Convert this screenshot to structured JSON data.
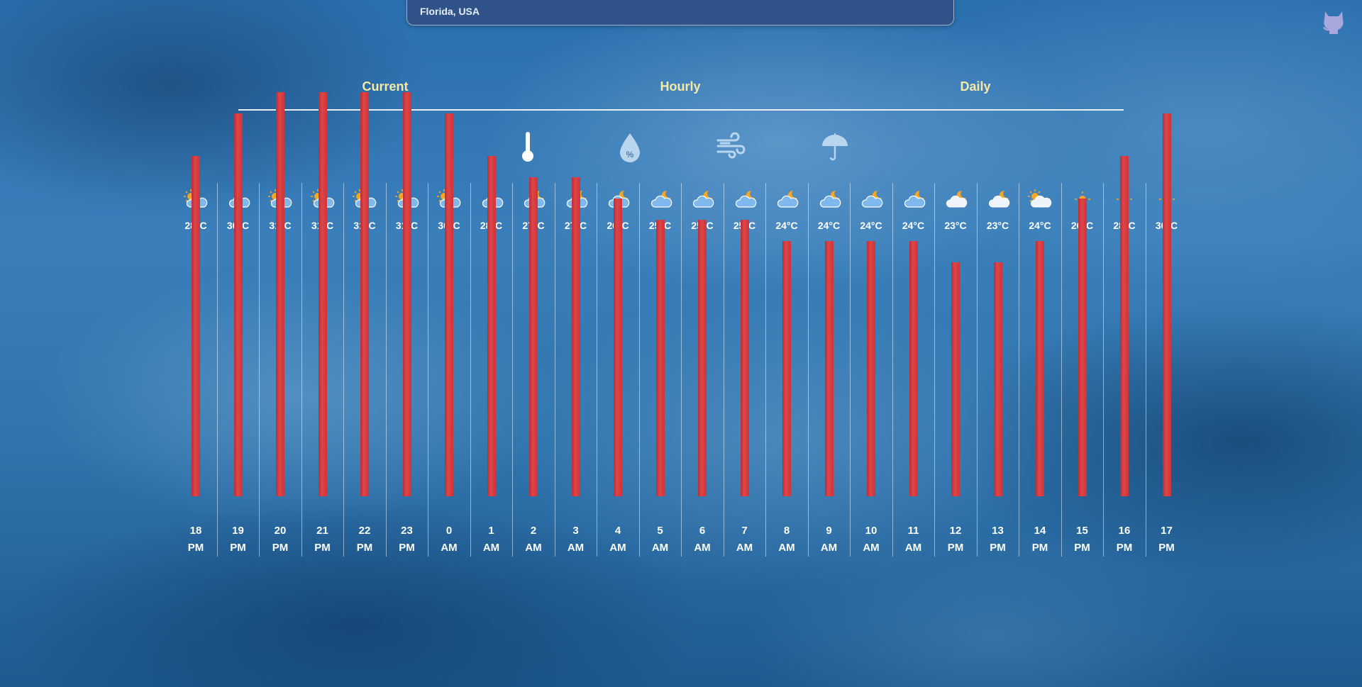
{
  "search": {
    "value": "Florida, USA"
  },
  "header": {
    "github_icon": "github-octocat-icon"
  },
  "tabs": [
    {
      "label": "Current"
    },
    {
      "label": "Hourly"
    },
    {
      "label": "Daily"
    }
  ],
  "metric_icons": [
    "thermometer-icon",
    "humidity-drop-icon",
    "wind-icon",
    "umbrella-icon"
  ],
  "colors": {
    "bar": "#d63c41",
    "tab_text": "#f7e8a4",
    "search_bg": "#2f5388"
  },
  "chart_data": {
    "type": "bar",
    "title": "",
    "unit": "°C",
    "categories": [
      "18 PM",
      "19 PM",
      "20 PM",
      "21 PM",
      "22 PM",
      "23 PM",
      "0 AM",
      "1 AM",
      "2 AM",
      "3 AM",
      "4 AM",
      "5 AM",
      "6 AM",
      "7 AM",
      "8 AM",
      "9 AM",
      "10 AM",
      "11 AM",
      "12 PM",
      "13 PM",
      "14 PM",
      "15 PM",
      "16 PM",
      "17 PM"
    ],
    "hours": [
      "18",
      "19",
      "20",
      "21",
      "22",
      "23",
      "0",
      "1",
      "2",
      "3",
      "4",
      "5",
      "6",
      "7",
      "8",
      "9",
      "10",
      "11",
      "12",
      "13",
      "14",
      "15",
      "16",
      "17"
    ],
    "periods": [
      "PM",
      "PM",
      "PM",
      "PM",
      "PM",
      "PM",
      "AM",
      "AM",
      "AM",
      "AM",
      "AM",
      "AM",
      "AM",
      "AM",
      "AM",
      "AM",
      "AM",
      "AM",
      "PM",
      "PM",
      "PM",
      "PM",
      "PM",
      "PM"
    ],
    "values": [
      28,
      30,
      31,
      31,
      31,
      31,
      30,
      28,
      27,
      27,
      26,
      25,
      25,
      25,
      24,
      24,
      24,
      24,
      23,
      23,
      24,
      26,
      28,
      30
    ],
    "labels": [
      "28°C",
      "30°C",
      "31°C",
      "31°C",
      "31°C",
      "31°C",
      "30°C",
      "28°C",
      "27°C",
      "27°C",
      "26°C",
      "25°C",
      "25°C",
      "25°C",
      "24°C",
      "24°C",
      "24°C",
      "24°C",
      "23°C",
      "23°C",
      "24°C",
      "26°C",
      "28°C",
      "30°C"
    ],
    "icons": [
      "sun-cloud-rain",
      "cloud",
      "sun-cloud-rain",
      "sun-cloud-rain",
      "sun-cloud-rain",
      "sun-cloud-rain",
      "sun-cloud-rain",
      "cloud",
      "moon-cloud",
      "moon-cloud",
      "moon-cloud",
      "moon-cloud",
      "moon-cloud",
      "moon-cloud",
      "moon-cloud",
      "moon-cloud",
      "moon-cloud",
      "moon-cloud",
      "moon-cloud-light",
      "moon-cloud-light",
      "sun-cloud-light",
      "sun",
      "sun",
      "sun"
    ],
    "grid": true
  }
}
